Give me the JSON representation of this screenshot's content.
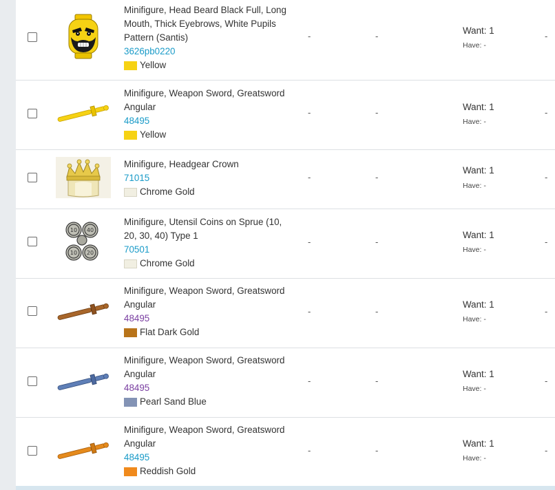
{
  "rows": [
    {
      "name": "Minifigure, Head Beard Black Full, Long Mouth, Thick Eyebrows, White Pupils Pattern (Santis)",
      "code": "3626pb0220",
      "color_name": "Yellow",
      "color_hex": "#f6d214",
      "col3": "-",
      "col4": "-",
      "want": "Want: 1",
      "have": "Have: -",
      "icon": "minifig-head-image"
    },
    {
      "name": "Minifigure, Weapon Sword, Greatsword Angular",
      "code": "48495",
      "color_name": "Yellow",
      "color_hex": "#f6d214",
      "col3": "-",
      "col4": "-",
      "want": "Want: 1",
      "have": "Have: -",
      "icon": "sword-image"
    },
    {
      "name": "Minifigure, Headgear Crown",
      "code": "71015",
      "color_name": "Chrome Gold",
      "color_hex": "#f1efe2",
      "col3": "-",
      "col4": "-",
      "want": "Want: 1",
      "have": "Have: -",
      "icon": "crown-image"
    },
    {
      "name": "Minifigure, Utensil Coins on Sprue (10, 20, 30, 40) Type 1",
      "code": "70501",
      "color_name": "Chrome Gold",
      "color_hex": "#f1efe2",
      "col3": "-",
      "col4": "-",
      "want": "Want: 1",
      "have": "Have: -",
      "icon": "coins-image"
    },
    {
      "name": "Minifigure, Weapon Sword, Greatsword Angular",
      "code": "48495",
      "color_name": "Flat Dark Gold",
      "color_hex": "#b8741a",
      "col3": "-",
      "col4": "-",
      "want": "Want: 1",
      "have": "Have: -",
      "icon": "sword-image"
    },
    {
      "name": "Minifigure, Weapon Sword, Greatsword Angular",
      "code": "48495",
      "color_name": "Pearl Sand Blue",
      "color_hex": "#8393b5",
      "col3": "-",
      "col4": "-",
      "want": "Want: 1",
      "have": "Have: -",
      "icon": "sword-image"
    },
    {
      "name": "Minifigure, Weapon Sword, Greatsword Angular",
      "code": "48495",
      "color_name": "Reddish Gold",
      "color_hex": "#f08a1d",
      "col3": "-",
      "col4": "-",
      "want": "Want: 1",
      "have": "Have: -",
      "icon": "sword-image"
    }
  ],
  "edge_marks": [
    "-",
    "-",
    "-",
    "-",
    "-",
    "-",
    "-"
  ],
  "colors": {
    "link": "#1a9bc8",
    "visited_link": "#7a3fa1",
    "divider": "#dcdfe3",
    "side_strip": "#e9ecef"
  }
}
